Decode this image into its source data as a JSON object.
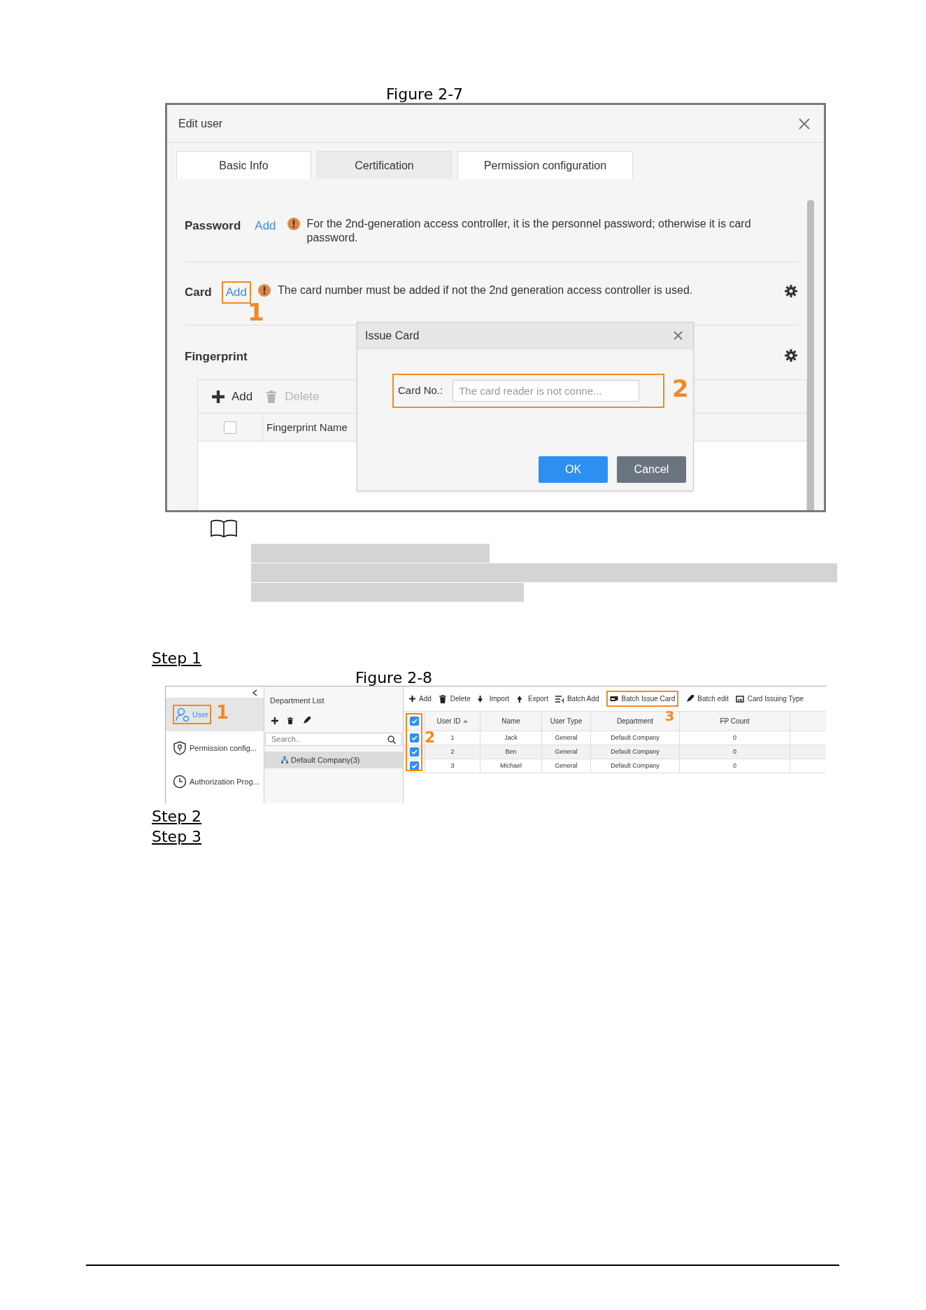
{
  "figure_1": {
    "caption": "Figure 2-7",
    "dialog": {
      "title": "Edit user",
      "tabs": [
        {
          "label": "Basic Info",
          "selected": false
        },
        {
          "label": "Certification",
          "selected": true
        },
        {
          "label": "Permission configuration",
          "selected": false
        }
      ],
      "sections": [
        {
          "label": "Password",
          "action": "Add",
          "highlighted": false,
          "settings": false,
          "note": "For the 2nd-generation access controller, it is the personnel password; otherwise it is card password."
        },
        {
          "label": "Card",
          "action": "Add",
          "highlighted": true,
          "callout": "1",
          "settings": true,
          "note": "The card number must be added if not the 2nd generation access controller is used."
        },
        {
          "label": "Fingerprint",
          "settings": true,
          "table": {
            "toolbar": [
              {
                "label": "Add",
                "disabled": false
              },
              {
                "label": "Delete",
                "disabled": true
              }
            ],
            "select_all_checked": false,
            "columns": [
              "Fingerprint Name"
            ]
          }
        }
      ]
    },
    "popup": {
      "title": "Issue Card",
      "field_label": "Card No.:",
      "placeholder": "The card reader is not conne...",
      "callout": "2",
      "buttons": [
        {
          "label": "OK",
          "kind": "primary"
        },
        {
          "label": "Cancel",
          "kind": "secondary"
        }
      ]
    }
  },
  "step_1": "Step 1",
  "figure_2": {
    "caption": "Figure 2-8",
    "sidebar": {
      "items": [
        {
          "label": "User",
          "selected": true,
          "highlighted": true,
          "callout": "1"
        },
        {
          "label": "Permission config...",
          "selected": false,
          "highlighted": false
        },
        {
          "label": "Authorization Prog...",
          "selected": false,
          "highlighted": false
        }
      ]
    },
    "departments": {
      "title": "Department List",
      "search_placeholder": "Search..",
      "tree": [
        {
          "label": "Default Company(3)",
          "selected": true
        }
      ]
    },
    "toolbar": [
      {
        "label": "Add",
        "highlighted": false
      },
      {
        "label": "Delete",
        "highlighted": false
      },
      {
        "label": "Import",
        "highlighted": false
      },
      {
        "label": "Export",
        "highlighted": false
      },
      {
        "label": "Batch Add",
        "highlighted": false
      },
      {
        "label": "Batch Issue Card",
        "highlighted": true,
        "callout": "3"
      },
      {
        "label": "Batch edit",
        "highlighted": false
      },
      {
        "label": "Card Issuing Type",
        "highlighted": false
      }
    ],
    "table": {
      "select_all_checked": true,
      "checkbox_callout": "2",
      "columns": [
        {
          "label": "User ID",
          "sorted": true
        },
        {
          "label": "Name",
          "sorted": false
        },
        {
          "label": "User Type",
          "sorted": false
        },
        {
          "label": "Department",
          "sorted": false
        },
        {
          "label": "FP Count",
          "sorted": false
        }
      ],
      "rows": [
        {
          "checked": true,
          "cells": [
            "1",
            "Jack",
            "General",
            "Default Company",
            "0"
          ]
        },
        {
          "checked": true,
          "cells": [
            "2",
            "Ben",
            "General",
            "Default Company",
            "0"
          ]
        },
        {
          "checked": true,
          "cells": [
            "3",
            "Michael",
            "General",
            "Default Company",
            "0"
          ]
        }
      ]
    }
  },
  "steps_after": [
    "Step 2",
    "Step 3"
  ]
}
